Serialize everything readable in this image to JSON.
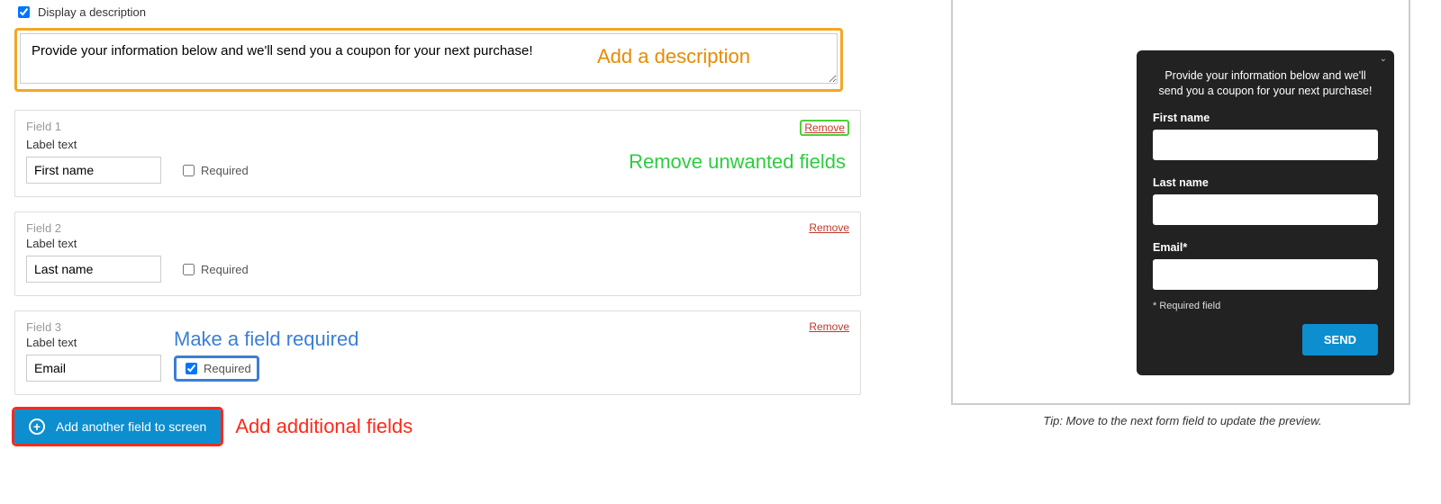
{
  "display_desc": {
    "label": "Display a description",
    "checked": true
  },
  "description_value": "Provide your information below and we'll send you a coupon for your next purchase!",
  "annotations": {
    "desc": "Add a description",
    "remove": "Remove unwanted fields",
    "required": "Make a field required",
    "add": "Add additional fields"
  },
  "field_labels": {
    "label_text": "Label text",
    "required": "Required",
    "remove": "Remove"
  },
  "fields": [
    {
      "title": "Field 1",
      "value": "First name",
      "required": false,
      "remove_boxed": true
    },
    {
      "title": "Field 2",
      "value": "Last name",
      "required": false,
      "remove_boxed": false
    },
    {
      "title": "Field 3",
      "value": "Email",
      "required": true,
      "remove_boxed": false,
      "req_boxed": true
    }
  ],
  "add_button": "Add another field to screen",
  "preview": {
    "desc": "Provide your information below and we'll send you a coupon for your next purchase!",
    "labels": {
      "first": "First name",
      "last": "Last name",
      "email": "Email*"
    },
    "required_note": "* Required field",
    "send": "SEND"
  },
  "tip": "Tip: Move to the next form field to update the preview."
}
